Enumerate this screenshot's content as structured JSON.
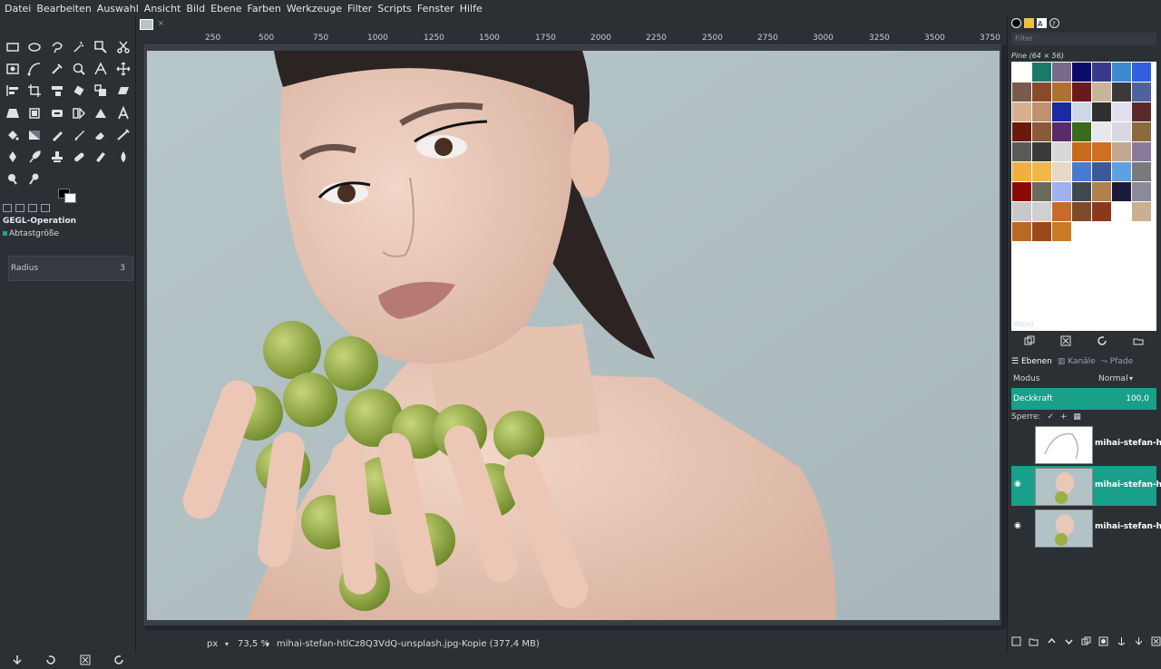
{
  "menu": [
    "Datei",
    "Bearbeiten",
    "Auswahl",
    "Ansicht",
    "Bild",
    "Ebene",
    "Farben",
    "Werkzeuge",
    "Filter",
    "Scripts",
    "Fenster",
    "Hilfe"
  ],
  "tool_options": {
    "title": "GEGL-Operation",
    "sample_label": "Abtastgröße",
    "radius_label": "Radius",
    "radius_value": "3"
  },
  "ruler": {
    "h_labels": [
      "250",
      "500",
      "750",
      "1000",
      "1250",
      "1500",
      "1750",
      "2000",
      "2250",
      "2500",
      "2750",
      "3000",
      "3250",
      "3500",
      "3750"
    ]
  },
  "status": {
    "unit": "px",
    "zoom": "73,5 %",
    "title": "mihai-stefan-htlCz8Q3VdQ-unsplash.jpg-Kopie (377,4 MB)"
  },
  "patterns": {
    "filter_placeholder": "Filter",
    "selected_name": "Pine (64 × 56)",
    "footer_name": "Wood,"
  },
  "layers": {
    "tabs": [
      "Ebenen",
      "Kanäle",
      "Pfade"
    ],
    "mode_label": "Modus",
    "mode_value": "Normal",
    "opacity_label": "Deckkraft",
    "opacity_value": "100,0",
    "lock_label": "Sperre:",
    "items": [
      {
        "name": "mihai-stefan-htlC",
        "visible": false,
        "active": false
      },
      {
        "name": "mihai-stefan-htlC",
        "visible": true,
        "active": true
      },
      {
        "name": "mihai-stefan-htlC",
        "visible": true,
        "active": false
      }
    ]
  },
  "colors": {
    "accent": "#18a08a",
    "background": "#2b3035"
  }
}
